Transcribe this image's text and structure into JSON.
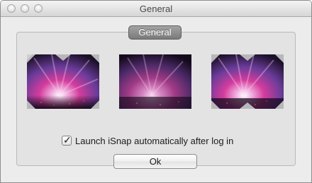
{
  "window": {
    "title": "General"
  },
  "tab": {
    "label": "General"
  },
  "thumbnails": [
    {
      "name": "aurora-wallpaper-thumbnail-left"
    },
    {
      "name": "aurora-wallpaper-thumbnail-middle"
    },
    {
      "name": "aurora-wallpaper-thumbnail-right"
    }
  ],
  "launch_option": {
    "label": "Launch iSnap automatically after log in",
    "checked": true,
    "checkmark": "✓"
  },
  "ok_button": {
    "label": "Ok"
  },
  "colors": {
    "window_bg": "#ececec",
    "tab_bg": "#8a8a8a",
    "aurora_magenta": "#d43c9c",
    "aurora_violet": "#6a3c9a",
    "space_dark": "#1a1028",
    "corner_gray": "#b8b8b8"
  },
  "icons": [
    "close-icon",
    "minimize-icon",
    "zoom-icon",
    "checkmark-icon"
  ]
}
